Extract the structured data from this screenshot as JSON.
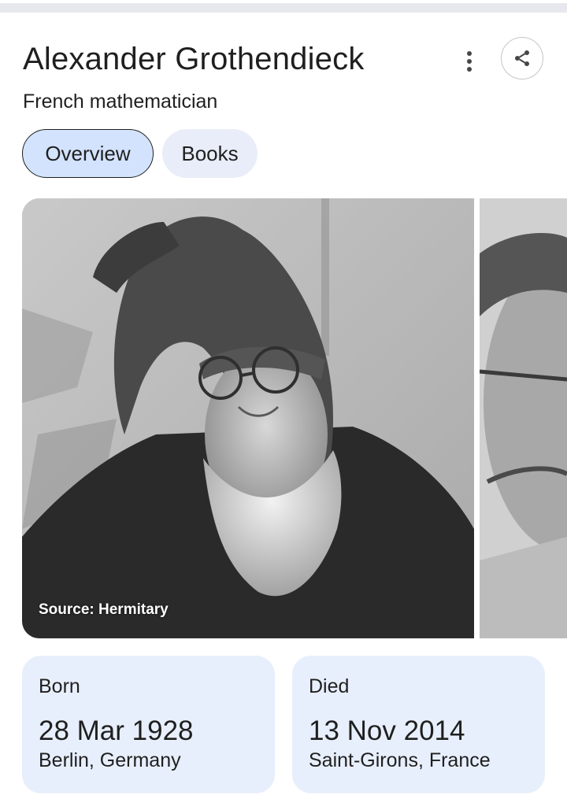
{
  "knowledge_panel": {
    "title": "Alexander Grothendieck",
    "subtitle": "French mathematician",
    "icons": {
      "more": "more-vert-icon",
      "share": "share-icon"
    },
    "tabs": [
      {
        "label": "Overview",
        "selected": true
      },
      {
        "label": "Books",
        "selected": false
      }
    ],
    "images": {
      "main_source": "Source: Hermitary"
    },
    "facts": [
      {
        "label": "Born",
        "date": "28 Mar 1928",
        "place": "Berlin, Germany"
      },
      {
        "label": "Died",
        "date": "13 Nov 2014",
        "place": "Saint-Girons, France"
      }
    ]
  },
  "colors": {
    "selected_tab_bg": "#d3e3fd",
    "unselected_tab_bg": "#e8edf9",
    "card_bg": "#e8effc",
    "text": "#1f1f1f"
  }
}
